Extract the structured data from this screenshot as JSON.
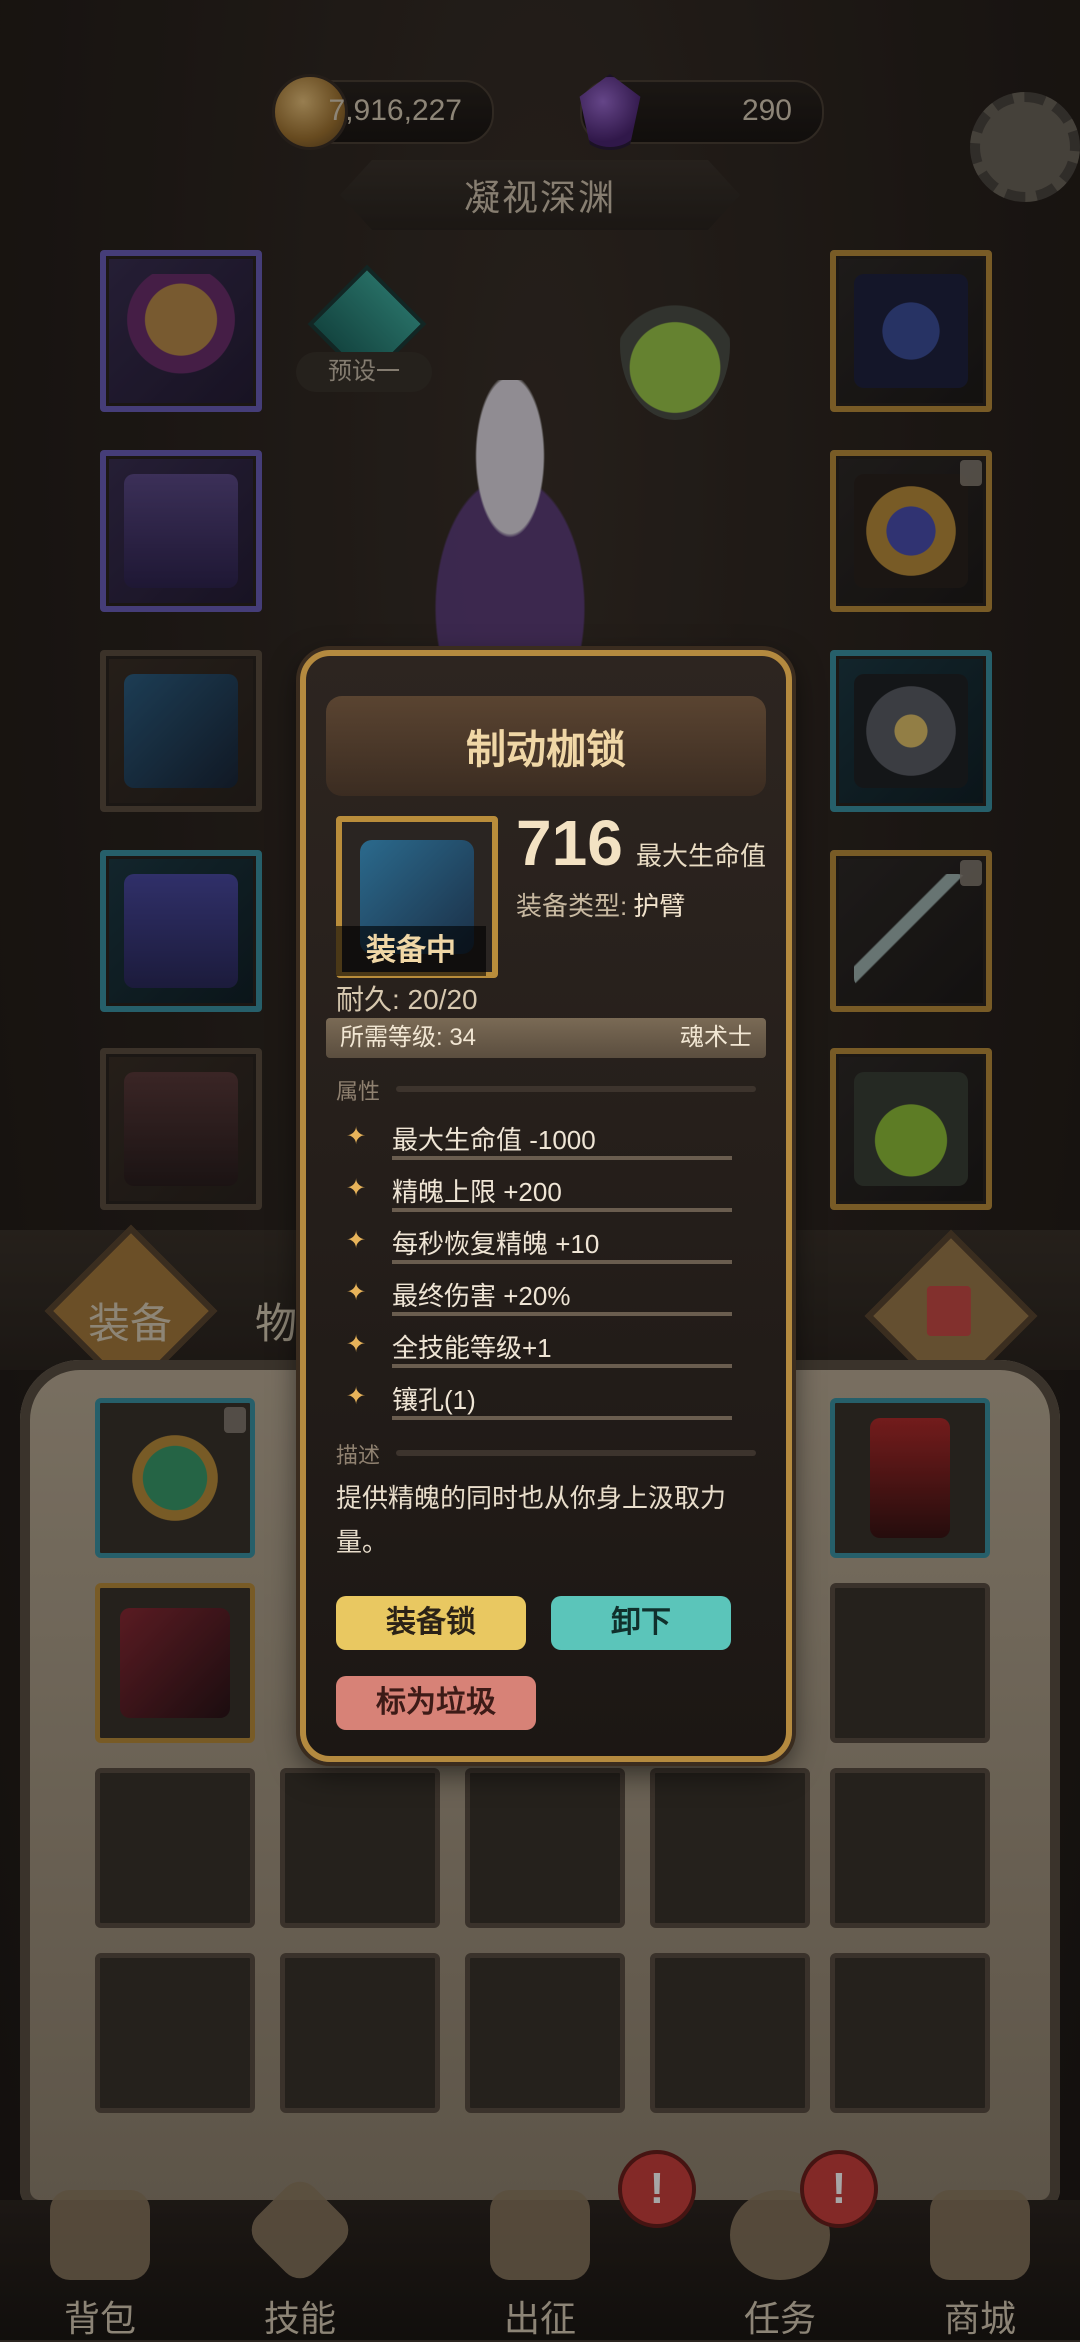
{
  "header": {
    "gold": "7,916,227",
    "gems": "290",
    "title": "凝视深渊"
  },
  "preset": {
    "label": "预设一"
  },
  "tabs": {
    "equipment": "装备",
    "items": "物品"
  },
  "item_detail": {
    "name": "制动枷锁",
    "equipped_badge": "装备中",
    "main_stat_value": "716",
    "main_stat_name": "最大生命值",
    "type_label": "装备类型:",
    "type_value": "护臂",
    "durability": "耐久: 20/20",
    "required_level": "所需等级: 34",
    "class": "魂术士",
    "attributes_heading": "属性",
    "attributes": [
      "最大生命值 -1000",
      "精魄上限 +200",
      "每秒恢复精魄 +10",
      "最终伤害 +20%",
      "全技能等级+1",
      "镶孔(1)"
    ],
    "description_heading": "描述",
    "description": "提供精魄的同时也从你身上汲取力量。",
    "buttons": {
      "lock": "装备锁",
      "unequip": "卸下",
      "junk": "标为垃圾"
    }
  },
  "bottom_nav": {
    "bag": "背包",
    "skills": "技能",
    "expedition": "出征",
    "tasks": "任务",
    "shop": "商城"
  },
  "colors": {
    "accent_gold": "#b48a3f",
    "unequip_teal": "#5bc5ba",
    "lock_yellow": "#e9c861",
    "junk_red": "#d78277",
    "alert_red": "#c9403c"
  },
  "icons": {
    "gold": "coin-icon",
    "gem": "purple-gem-icon",
    "settings": "gear-icon",
    "trash": "trash-icon",
    "alert": "exclamation-icon"
  }
}
